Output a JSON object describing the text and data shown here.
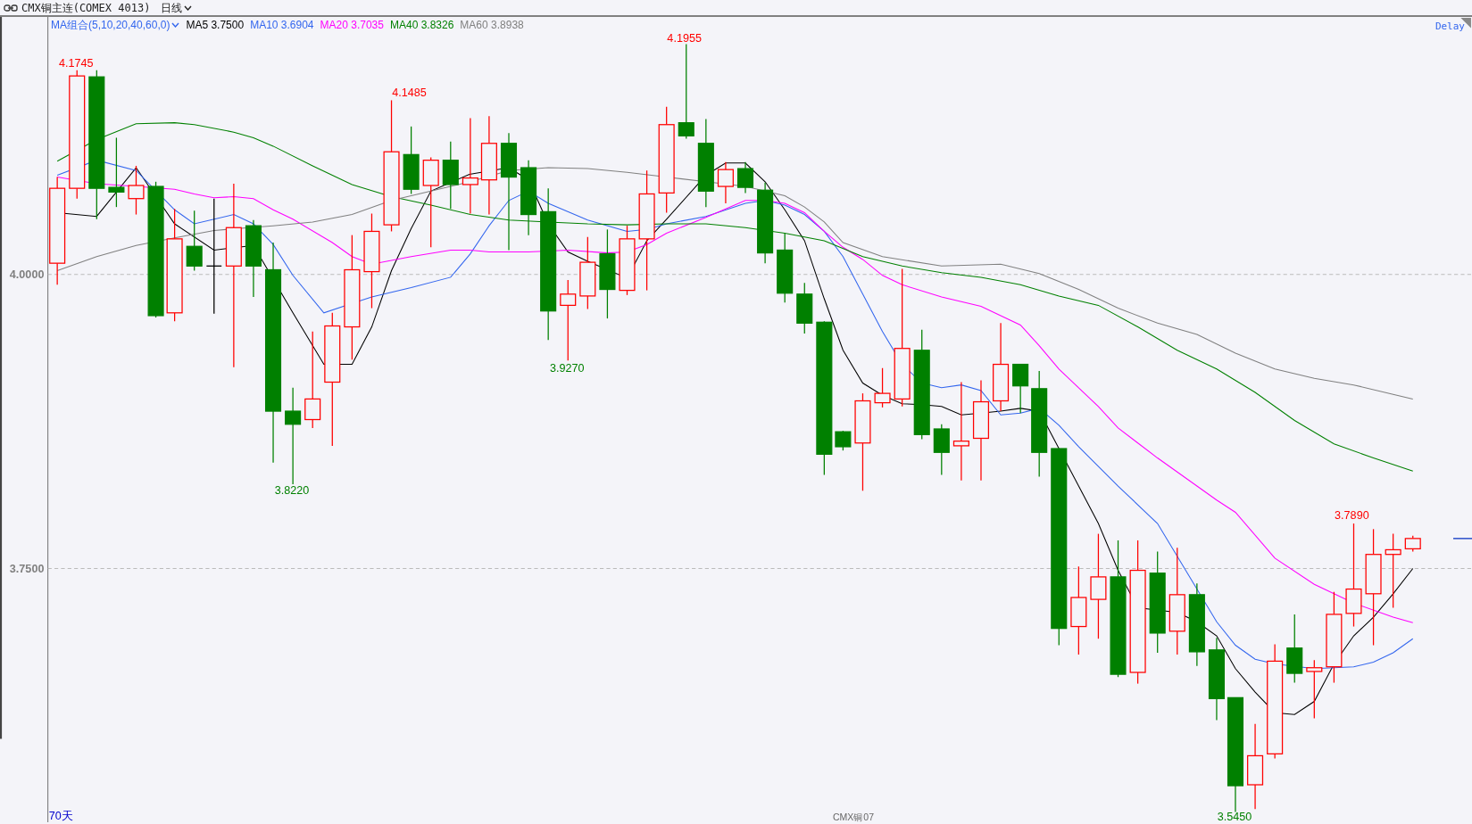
{
  "header": {
    "title": "CMX铜主连(COMEX 4013)",
    "period": "日线"
  },
  "legend": {
    "combo": "MA组合(5,10,20,40,60,0)",
    "items": [
      {
        "label": "MA5",
        "value": "3.7500",
        "color": "#000000"
      },
      {
        "label": "MA10",
        "value": "3.6904",
        "color": "#3366ee"
      },
      {
        "label": "MA20",
        "value": "3.7035",
        "color": "#ff00ff"
      },
      {
        "label": "MA40",
        "value": "3.8326",
        "color": "#008000"
      },
      {
        "label": "MA60",
        "value": "3.8938",
        "color": "#808080"
      }
    ]
  },
  "delay": "Delay",
  "y_axis_labels": [
    "4.0000",
    "3.7500"
  ],
  "extreme_labels": [
    {
      "text": "4.1745",
      "kind": "high"
    },
    {
      "text": "4.1485",
      "kind": "high"
    },
    {
      "text": "4.1955",
      "kind": "high"
    },
    {
      "text": "3.9270",
      "kind": "low"
    },
    {
      "text": "3.8220",
      "kind": "low"
    },
    {
      "text": "3.5450",
      "kind": "low"
    },
    {
      "text": "3.7890",
      "kind": "high"
    }
  ],
  "footer": {
    "bar_count": "70天",
    "contract": "CMX铜07"
  }
}
